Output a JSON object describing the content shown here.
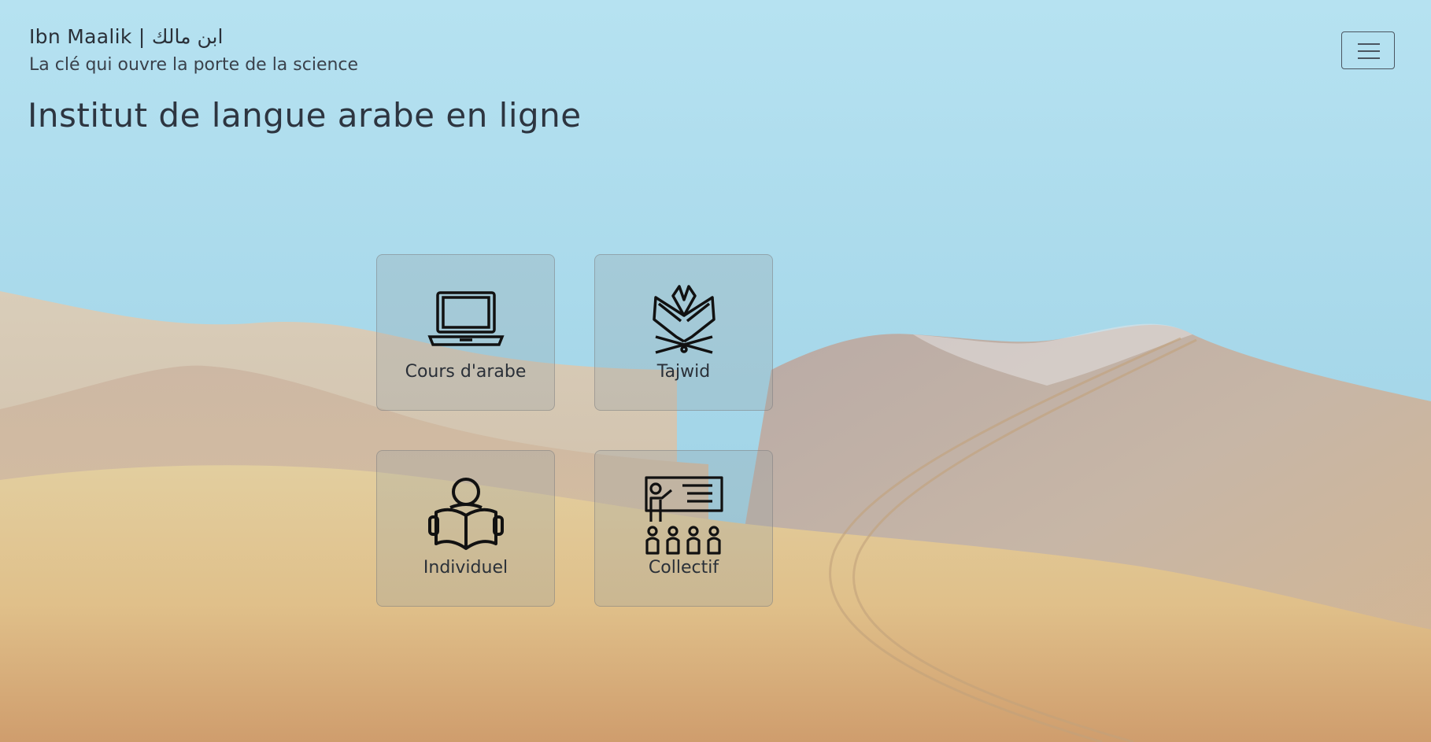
{
  "header": {
    "brand": "Ibn Maalik | ابن مالك",
    "tagline": "La clé qui ouvre la porte de la science",
    "title": "Institut de langue arabe en ligne"
  },
  "nav": {
    "menu_icon": "hamburger-icon"
  },
  "cards": [
    {
      "label": "Cours d'arabe",
      "icon": "laptop-icon"
    },
    {
      "label": "Tajwid",
      "icon": "quran-book-icon"
    },
    {
      "label": "Individuel",
      "icon": "reader-icon"
    },
    {
      "label": "Collectif",
      "icon": "classroom-icon"
    }
  ],
  "colors": {
    "text": "#2a3038",
    "sky": "#a3d6e8",
    "sand": "#dcbf8d"
  }
}
